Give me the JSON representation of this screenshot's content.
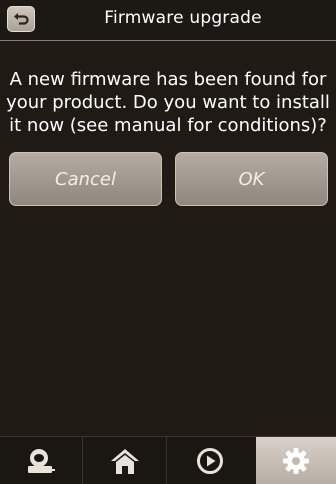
{
  "header": {
    "title": "Firmware upgrade",
    "back_icon": "back-arrow-icon"
  },
  "dialog": {
    "message": "A new firmware has been found for your product. Do you want to install it now (see manual for conditions)?",
    "cancel_label": "Cancel",
    "ok_label": "OK"
  },
  "tabbar": {
    "tabs": [
      {
        "icon": "webcam-device-icon"
      },
      {
        "icon": "home-icon"
      },
      {
        "icon": "play-icon"
      },
      {
        "icon": "gear-icon",
        "selected": true
      }
    ]
  },
  "colors": {
    "background": "#1f1a14",
    "button": "#a39b92",
    "selected_tab": "#cfc7be"
  }
}
